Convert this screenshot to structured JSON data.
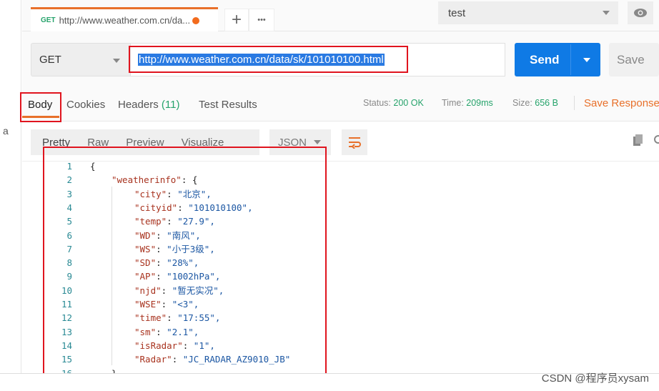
{
  "left_strip": {
    "fragment": "a"
  },
  "tab": {
    "method": "GET",
    "title": "http://www.weather.com.cn/da...",
    "new_tab": "+",
    "more": "•••"
  },
  "environment": {
    "selected": "test"
  },
  "request": {
    "method": "GET",
    "url": "http://www.weather.com.cn/data/sk/101010100.html",
    "send_label": "Send",
    "save_label": "Save"
  },
  "response_tabs": [
    {
      "label": "Body"
    },
    {
      "label": "Cookies"
    },
    {
      "label": "Headers ",
      "count": "(11)"
    },
    {
      "label": "Test Results"
    }
  ],
  "status": {
    "status_label": "Status:",
    "status": "200 OK",
    "time_label": "Time:",
    "time": "209ms",
    "size_label": "Size:",
    "size": "656 B",
    "save_response": "Save Response"
  },
  "format": {
    "tabs": [
      "Pretty",
      "Raw",
      "Preview",
      "Visualize"
    ],
    "type": "JSON"
  },
  "code": {
    "open_brace": "{",
    "root_key": "\"weatherinfo\"",
    "fields": [
      {
        "k": "\"city\"",
        "v": "\"北京\","
      },
      {
        "k": "\"cityid\"",
        "v": "\"101010100\","
      },
      {
        "k": "\"temp\"",
        "v": "\"27.9\","
      },
      {
        "k": "\"WD\"",
        "v": "\"南风\","
      },
      {
        "k": "\"WS\"",
        "v": "\"小于3级\","
      },
      {
        "k": "\"SD\"",
        "v": "\"28%\","
      },
      {
        "k": "\"AP\"",
        "v": "\"1002hPa\","
      },
      {
        "k": "\"njd\"",
        "v": "\"暂无实况\","
      },
      {
        "k": "\"WSE\"",
        "v": "\"<3\","
      },
      {
        "k": "\"time\"",
        "v": "\"17:55\","
      },
      {
        "k": "\"sm\"",
        "v": "\"2.1\","
      },
      {
        "k": "\"isRadar\"",
        "v": "\"1\","
      },
      {
        "k": "\"Radar\"",
        "v": "\"JC_RADAR_AZ9010_JB\""
      }
    ],
    "close_brace": "}"
  },
  "watermark": "CSDN @程序员xysam",
  "colors": {
    "accent": "#e8702a",
    "send": "#0f7ae5",
    "success": "#26a36b",
    "highlight": "#e0141e"
  }
}
